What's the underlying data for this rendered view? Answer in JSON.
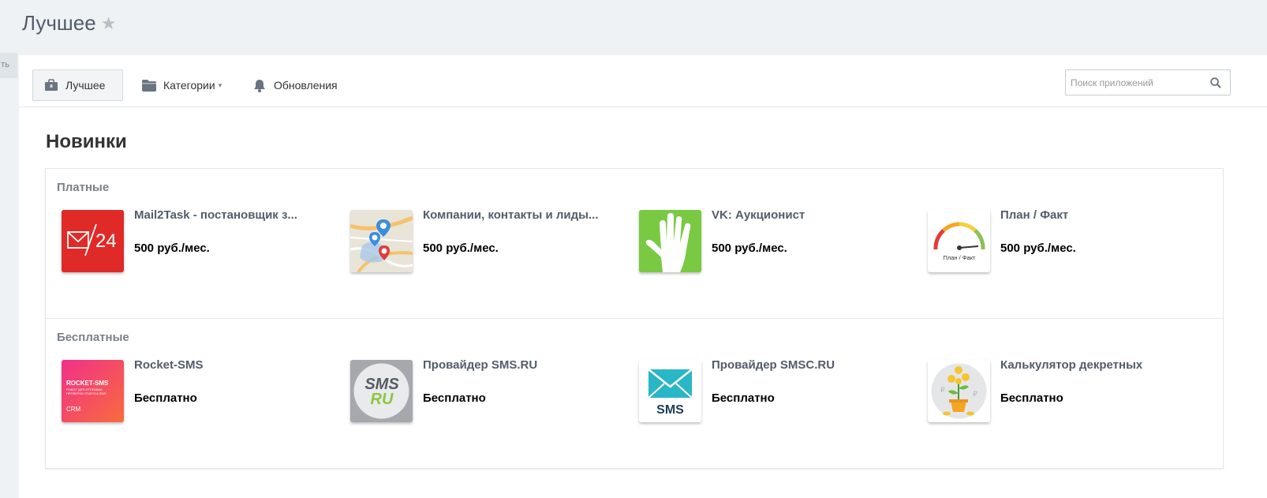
{
  "page": {
    "title": "Лучшее",
    "star": "★"
  },
  "left_tab": {
    "label": "ть"
  },
  "toolbar": {
    "tabs": [
      {
        "label": "Лучшее",
        "icon": "briefcase-icon",
        "active": true
      },
      {
        "label": "Категории",
        "icon": "folder-icon",
        "caret": "▾"
      },
      {
        "label": "Обновления",
        "icon": "bell-icon"
      }
    ],
    "search": {
      "placeholder": "Поиск приложений",
      "value": ""
    }
  },
  "section": {
    "title": "Новинки"
  },
  "groups": [
    {
      "label": "Платные",
      "apps": [
        {
          "name": "Mail2Task - постановщик з...",
          "price": "500 руб./мес.",
          "icon": "mail2task-icon",
          "icon_text": "24"
        },
        {
          "name": "Компании, контакты и лиды...",
          "price": "500 руб./мес.",
          "icon": "map-pins-icon"
        },
        {
          "name": "VK: Аукционист",
          "price": "500 руб./мес.",
          "icon": "hand-icon"
        },
        {
          "name": "План / Факт",
          "price": "500 руб./мес.",
          "icon": "gauge-icon",
          "icon_text": "План / Факт"
        }
      ]
    },
    {
      "label": "Бесплатные",
      "apps": [
        {
          "name": "Rocket-SMS",
          "price": "Бесплатно",
          "icon": "rocket-sms-icon",
          "icon_text": "ROCKET-SMS",
          "icon_subtext": "РОБОТ ДЛЯ ОТПРАВКИ ПРОВЕРКИ СТАТУСА SMS",
          "icon_footer": "CRM"
        },
        {
          "name": "Провайдер SMS.RU",
          "price": "Бесплатно",
          "icon": "sms-ru-icon",
          "icon_text": "SMS",
          "icon_subtext": "RU"
        },
        {
          "name": "Провайдер SMSC.RU",
          "price": "Бесплатно",
          "icon": "envelope-sms-icon",
          "icon_text": "SMS"
        },
        {
          "name": "Калькулятор декретных",
          "price": "Бесплатно",
          "icon": "money-tree-icon",
          "icon_text": "₽"
        }
      ]
    }
  ],
  "colors": {
    "background": "#eef2f4",
    "mail2task_red": "#e02a27",
    "vk_green": "#7ac943",
    "rocket_gradient": [
      "#f0308a",
      "#f96b3c"
    ],
    "smsc_blue": "#29b6c6"
  }
}
